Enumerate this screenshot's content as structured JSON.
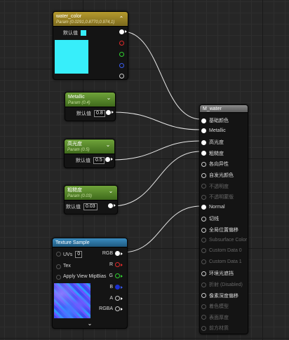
{
  "colors": {
    "swatch": "#37eefa",
    "param_header": "#6b9a33",
    "color_header": "#9b8527",
    "texture_header": "#2f7ba8",
    "wire": "#e8e8e8"
  },
  "water_color": {
    "title": "water_color",
    "subtitle": "Param (0.0291,0.8770,0.974,1)",
    "default_label": "默认值",
    "output_pins": [
      "white",
      "red",
      "green",
      "blue",
      "alpha"
    ]
  },
  "metallic": {
    "title": "Metallic",
    "subtitle": "Param (0.4)",
    "default_label": "默认值",
    "value": "0.8"
  },
  "gloss": {
    "title": "高光度",
    "subtitle": "Param (0.5)",
    "default_label": "默认值",
    "value": "0.5"
  },
  "roughness": {
    "title": "粗糙度",
    "subtitle": "Param (0.03)",
    "default_label": "默认值",
    "value": "0.03"
  },
  "texture": {
    "title": "Texture Sample",
    "inputs": {
      "uvs": "UVs",
      "uvs_value": "0",
      "tex": "Tex",
      "mip": "Apply View MipBias"
    },
    "outputs": {
      "rgb": "RGB",
      "r": "R",
      "g": "G",
      "b": "B",
      "a": "A",
      "rgba": "RGBA"
    }
  },
  "material": {
    "title": "M_water",
    "inputs": [
      {
        "label": "基础颜色",
        "active": true
      },
      {
        "label": "Metallic",
        "active": true
      },
      {
        "label": "高光度",
        "active": true
      },
      {
        "label": "粗糙度",
        "active": true
      },
      {
        "label": "各向异性",
        "active": true
      },
      {
        "label": "自发光颜色",
        "active": true
      },
      {
        "label": "不透明度",
        "active": false
      },
      {
        "label": "不透明蒙版",
        "active": false
      },
      {
        "label": "Normal",
        "active": true
      },
      {
        "label": "切线",
        "active": true
      },
      {
        "label": "全局位置偏移",
        "active": true
      },
      {
        "label": "Subsurface Color",
        "active": false
      },
      {
        "label": "Custom Data 0",
        "active": false
      },
      {
        "label": "Custom Data 1",
        "active": false
      },
      {
        "label": "环境光遮挡",
        "active": true
      },
      {
        "label": "折射 (Disabled)",
        "active": false
      },
      {
        "label": "像素深度偏移",
        "active": true
      },
      {
        "label": "着色模型",
        "active": false
      },
      {
        "label": "表面厚度",
        "active": false
      },
      {
        "label": "前方材质",
        "active": false
      }
    ]
  }
}
